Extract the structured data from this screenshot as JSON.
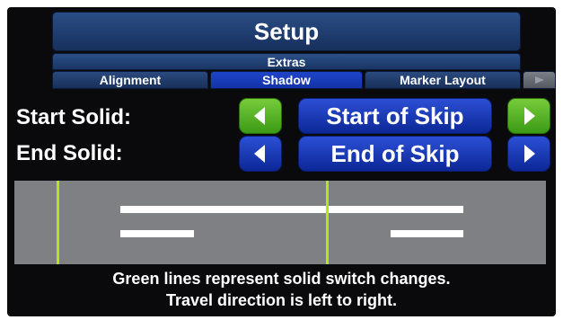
{
  "header": {
    "title": "Setup"
  },
  "tabs": {
    "upper": "Extras",
    "lower": [
      {
        "label": "Alignment"
      },
      {
        "label": "Shadow"
      },
      {
        "label": "Marker Layout"
      }
    ]
  },
  "rows": [
    {
      "label": "Start Solid:",
      "value": "Start of Skip",
      "arrow_style": "green"
    },
    {
      "label": "End Solid:",
      "value": "End of Skip",
      "arrow_style": "blue"
    }
  ],
  "diagram": {
    "switch_line_color": "#b6e61a",
    "stripe_color": "#ffffff"
  },
  "caption": {
    "line1": "Green lines represent solid switch changes.",
    "line2": "Travel direction is left to right."
  },
  "colors": {
    "tab_blue": "#1a3563",
    "tab_active": "#1233a8",
    "button_blue": "#0c2796",
    "button_green": "#3c9a16"
  },
  "icons": [
    "left-arrow-icon",
    "right-arrow-icon"
  ]
}
